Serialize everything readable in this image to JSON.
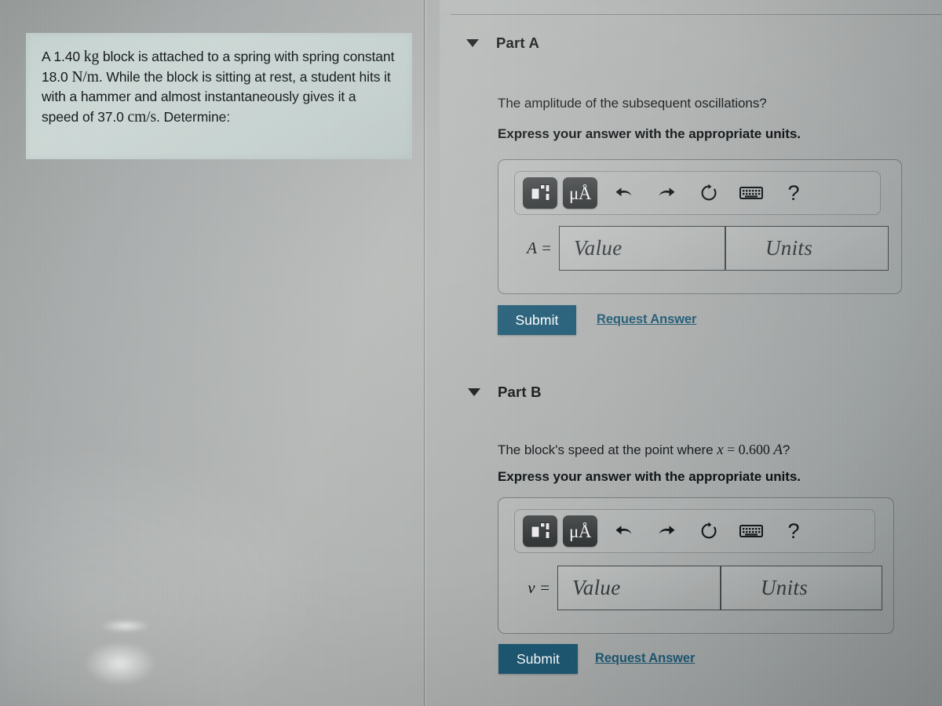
{
  "problem": {
    "segments": [
      {
        "t": "A 1.40 ",
        "s": "plain"
      },
      {
        "t": "kg",
        "s": "math"
      },
      {
        "t": " block is attached to a spring with spring constant 18.0 ",
        "s": "plain"
      },
      {
        "t": "N/m",
        "s": "math"
      },
      {
        "t": ". While the block is sitting at rest, a student hits it with a hammer and almost instantaneously gives it a speed of 37.0 ",
        "s": "plain"
      },
      {
        "t": "cm/s",
        "s": "math"
      },
      {
        "t": ". Determine:",
        "s": "plain"
      }
    ],
    "mass": "1.40 kg",
    "spring_constant": "18.0 N/m",
    "speed": "37.0 cm/s",
    "card_color": "#ccd8d5"
  },
  "express_units_note": "Express your answer with the appropriate units.",
  "toolbar": {
    "template_icon": "template-layout-icon",
    "units_button_label": "μÅ",
    "undo_icon": "undo-arrow-icon",
    "redo_icon": "redo-arrow-icon",
    "reset_icon": "reset-circular-arrow-icon",
    "keyboard_icon": "keyboard-icon",
    "help_label": "?"
  },
  "fields": {
    "value_placeholder": "Value",
    "units_placeholder": "Units"
  },
  "actions": {
    "submit_label": "Submit",
    "request_answer_label": "Request Answer",
    "submit_color": "#1d5873"
  },
  "parts": [
    {
      "id": "a",
      "title": "Part A",
      "caret": "caret-down-icon",
      "question": "The amplitude of the subsequent oscillations?",
      "question_prefix": "The amplitude of the subsequent oscillations?",
      "variable_label": "A =",
      "variable_symbol": "A"
    },
    {
      "id": "b",
      "title": "Part B",
      "caret": "caret-down-icon",
      "question_prefix": "The block's speed at the point where ",
      "question_math_var": "x",
      "question_math_eq": " = 0.600 ",
      "question_math_amp": "A",
      "question_suffix": "?",
      "variable_label": "v =",
      "variable_symbol": "v"
    }
  ]
}
